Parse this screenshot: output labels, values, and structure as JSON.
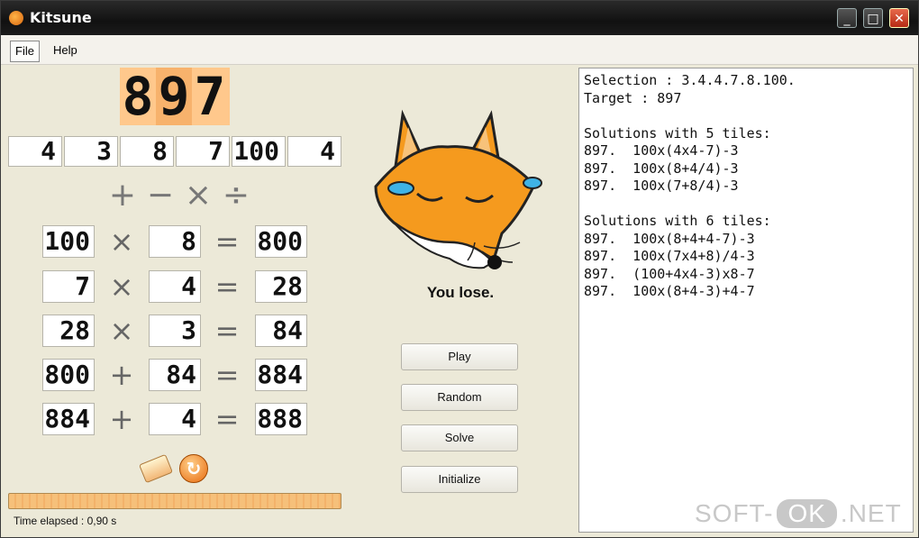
{
  "window": {
    "title": "Kitsune",
    "minimize": "_",
    "maximize": "□",
    "close": "✕"
  },
  "menu": {
    "file": "File",
    "help": "Help"
  },
  "target_digits": [
    "8",
    "9",
    "7"
  ],
  "tiles": [
    "4",
    "3",
    "8",
    "7",
    "100",
    "4"
  ],
  "operators": [
    "+",
    "−",
    "×",
    "÷"
  ],
  "equations": [
    {
      "a": "100",
      "op": "×",
      "b": "8",
      "eq": "=",
      "r": "800"
    },
    {
      "a": "7",
      "op": "×",
      "b": "4",
      "eq": "=",
      "r": "28"
    },
    {
      "a": "28",
      "op": "×",
      "b": "3",
      "eq": "=",
      "r": "84"
    },
    {
      "a": "800",
      "op": "+",
      "b": "84",
      "eq": "=",
      "r": "884"
    },
    {
      "a": "884",
      "op": "+",
      "b": "4",
      "eq": "=",
      "r": "888"
    }
  ],
  "icons": {
    "eraser": "eraser-icon",
    "refresh": "refresh-icon",
    "refresh_glyph": "↻",
    "fox": "crying-fox-icon"
  },
  "progress_fraction": 1.0,
  "status": "Time elapsed : 0,90 s",
  "result_text": "You lose.",
  "buttons": {
    "play": "Play",
    "random": "Random",
    "solve": "Solve",
    "initialize": "Initialize"
  },
  "solutions": [
    "Selection : 3.4.4.7.8.100.",
    "Target : 897",
    "",
    "Solutions with 5 tiles:",
    "897.  100x(4x4-7)-3",
    "897.  100x(8+4/4)-3",
    "897.  100x(7+8/4)-3",
    "",
    "Solutions with 6 tiles:",
    "897.  100x(8+4+4-7)-3",
    "897.  100x(7x4+8)/4-3",
    "897.  (100+4x4-3)x8-7",
    "897.  100x(8+4-3)+4-7"
  ],
  "watermark": {
    "left": "SOFT-",
    "ok": "OK",
    "right": ".NET"
  },
  "colors": {
    "accent": "#ffc88c",
    "fox_orange": "#f59a1e",
    "tear_blue": "#3fb3e6"
  }
}
